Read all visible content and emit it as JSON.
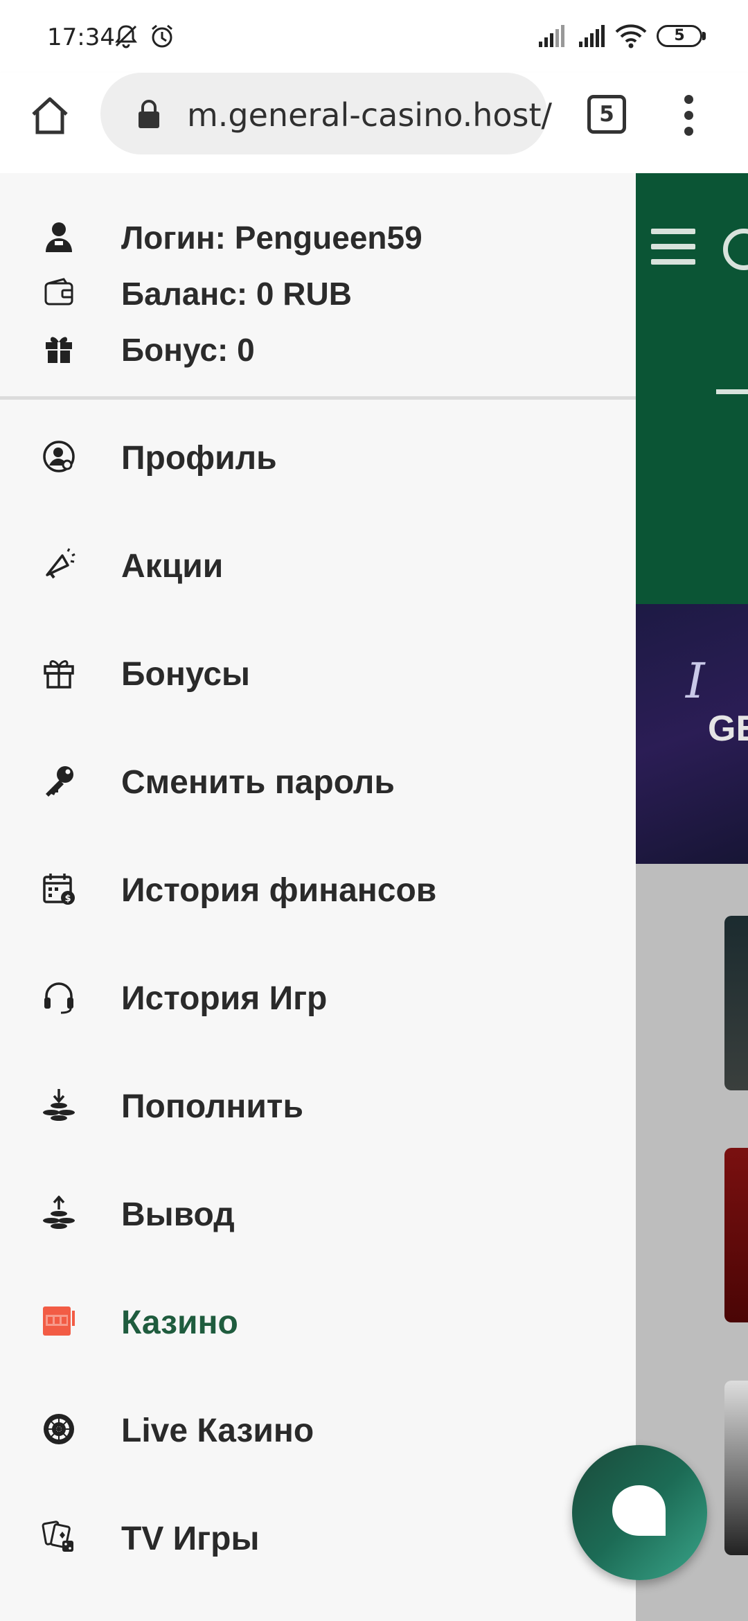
{
  "status_bar": {
    "time": "17:34",
    "battery": "5",
    "icons": [
      "mute-icon",
      "alarm-icon",
      "signal-icon",
      "signal-icon",
      "wifi-icon",
      "battery-icon"
    ]
  },
  "browser": {
    "url": "m.general-casino.host/",
    "tab_count": "5",
    "icons": [
      "home-icon",
      "lock-icon",
      "tabs-icon",
      "overflow-menu-icon"
    ]
  },
  "drawer": {
    "user": {
      "login": "Логин: Pengueen59",
      "balance": "Баланс: 0 RUB",
      "bonus": "Бонус: 0"
    },
    "items": [
      {
        "label": "Профиль",
        "icon": "profile-icon"
      },
      {
        "label": "Акции",
        "icon": "megaphone-icon"
      },
      {
        "label": "Бонусы",
        "icon": "gift-icon"
      },
      {
        "label": "Сменить пароль",
        "icon": "key-icon"
      },
      {
        "label": "История финансов",
        "icon": "calendar-money-icon"
      },
      {
        "label": "История Игр",
        "icon": "headset-icon"
      },
      {
        "label": "Пополнить",
        "icon": "deposit-coins-icon"
      },
      {
        "label": "Вывод",
        "icon": "withdraw-coins-icon"
      },
      {
        "label": "Казино",
        "icon": "slot-machine-icon",
        "active": true
      },
      {
        "label": "Live Казино",
        "icon": "roulette-icon"
      },
      {
        "label": "TV Игры",
        "icon": "cards-dice-icon"
      }
    ]
  },
  "background_page": {
    "header_color": "#0b5535",
    "banner_text": [
      "I",
      "GE"
    ]
  },
  "colors": {
    "accent": "#1f5c3e",
    "active_icon": "#f25c45",
    "chat_button": "#1c6b55"
  }
}
